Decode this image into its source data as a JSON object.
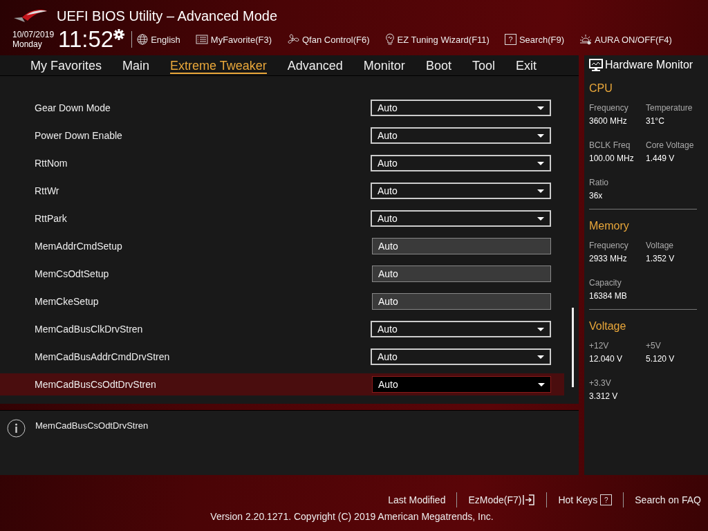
{
  "window": {
    "title": "UEFI BIOS Utility – Advanced Mode"
  },
  "clock": {
    "date": "10/07/2019",
    "day": "Monday",
    "time": "11:52"
  },
  "toolbar": [
    {
      "kind": "globe",
      "label": "English"
    },
    {
      "kind": "favorite",
      "label": "MyFavorite(F3)"
    },
    {
      "kind": "fan",
      "label": "Qfan Control(F6)"
    },
    {
      "kind": "bulb",
      "label": "EZ Tuning Wizard(F11)"
    },
    {
      "kind": "help",
      "label": "Search(F9)",
      "icon": "?"
    },
    {
      "kind": "aura",
      "label": "AURA ON/OFF(F4)"
    }
  ],
  "tabs": [
    {
      "label": "My Favorites",
      "selected": false
    },
    {
      "label": "Main",
      "selected": false
    },
    {
      "label": "Extreme Tweaker",
      "selected": true
    },
    {
      "label": "Advanced",
      "selected": false
    },
    {
      "label": "Monitor",
      "selected": false
    },
    {
      "label": "Boot",
      "selected": false
    },
    {
      "label": "Tool",
      "selected": false
    },
    {
      "label": "Exit",
      "selected": false
    }
  ],
  "settings": [
    {
      "name": "Gear Down Mode",
      "value": "Auto",
      "kind": "dropdown",
      "selected": false
    },
    {
      "name": "Power Down Enable",
      "value": "Auto",
      "kind": "dropdown",
      "selected": false
    },
    {
      "name": "RttNom",
      "value": "Auto",
      "kind": "dropdown",
      "selected": false
    },
    {
      "name": "RttWr",
      "value": "Auto",
      "kind": "dropdown",
      "selected": false
    },
    {
      "name": "RttPark",
      "value": "Auto",
      "kind": "dropdown",
      "selected": false
    },
    {
      "name": "MemAddrCmdSetup",
      "value": "Auto",
      "kind": "readonly",
      "selected": false
    },
    {
      "name": "MemCsOdtSetup",
      "value": "Auto",
      "kind": "readonly",
      "selected": false
    },
    {
      "name": "MemCkeSetup",
      "value": "Auto",
      "kind": "readonly",
      "selected": false
    },
    {
      "name": "MemCadBusClkDrvStren",
      "value": "Auto",
      "kind": "dropdown",
      "selected": false
    },
    {
      "name": "MemCadBusAddrCmdDrvStren",
      "value": "Auto",
      "kind": "dropdown",
      "selected": false
    },
    {
      "name": "MemCadBusCsOdtDrvStren",
      "value": "Auto",
      "kind": "dropdown",
      "selected": true
    }
  ],
  "help": {
    "text": "MemCadBusCsOdtDrvStren"
  },
  "hardware_monitor": {
    "title": "Hardware Monitor",
    "sections": [
      {
        "title": "CPU",
        "items": [
          {
            "label": "Frequency",
            "value": "3600 MHz"
          },
          {
            "label": "Temperature",
            "value": "31°C"
          },
          {
            "label": "BCLK Freq",
            "value": "100.00 MHz"
          },
          {
            "label": "Core Voltage",
            "value": "1.449 V"
          },
          {
            "label": "Ratio",
            "value": "36x"
          }
        ]
      },
      {
        "title": "Memory",
        "items": [
          {
            "label": "Frequency",
            "value": "2933 MHz"
          },
          {
            "label": "Voltage",
            "value": "1.352 V"
          },
          {
            "label": "Capacity",
            "value": "16384 MB"
          }
        ]
      },
      {
        "title": "Voltage",
        "items": [
          {
            "label": "+12V",
            "value": "12.040 V"
          },
          {
            "label": "+5V",
            "value": "5.120 V"
          },
          {
            "label": "+3.3V",
            "value": "3.312 V"
          }
        ]
      }
    ]
  },
  "footer": {
    "links": [
      {
        "label": "Last Modified",
        "kind": "plain"
      },
      {
        "label": "EzMode(F7)",
        "kind": "exit"
      },
      {
        "label": "Hot Keys",
        "kind": "keys",
        "icon": "?"
      },
      {
        "label": "Search on FAQ",
        "kind": "plain"
      }
    ],
    "copyright": "Version 2.20.1271. Copyright (C) 2019 American Megatrends, Inc."
  }
}
